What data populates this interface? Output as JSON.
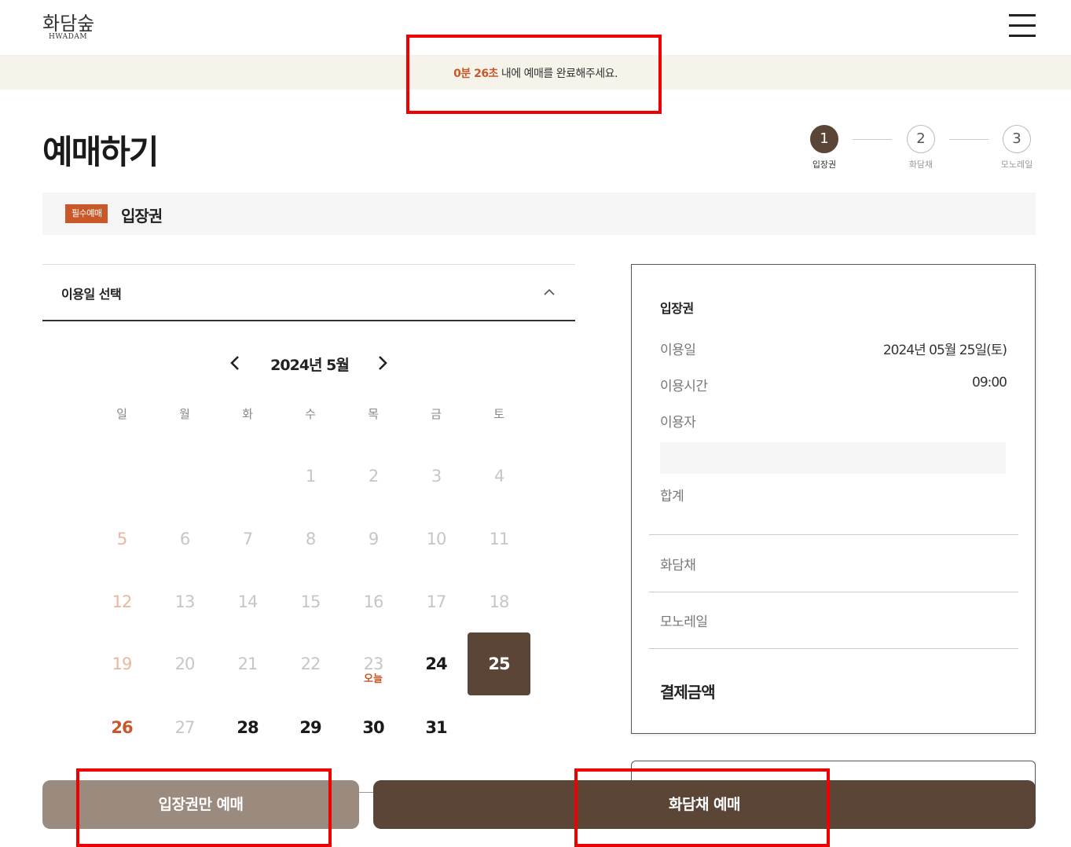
{
  "header": {
    "logo_ko": "화담숲",
    "logo_en": "HWADAM",
    "menu_icon": "hamburger-menu-icon"
  },
  "timer": {
    "count": "0분 26초",
    "message": " 내에 예매를 완료해주세요."
  },
  "page": {
    "title": "예매하기"
  },
  "stepper": {
    "steps": [
      {
        "number": "1",
        "label": "입장권",
        "active": true
      },
      {
        "number": "2",
        "label": "화담채",
        "active": false
      },
      {
        "number": "3",
        "label": "모노레일",
        "active": false
      }
    ]
  },
  "section": {
    "badge": "필수예매",
    "title": "입장권"
  },
  "date_picker": {
    "title": "이용일 선택",
    "month_label": "2024년 5월",
    "weekdays": [
      "일",
      "월",
      "화",
      "수",
      "목",
      "금",
      "토"
    ],
    "today_label": "오늘",
    "days": [
      "1",
      "2",
      "3",
      "4",
      "5",
      "6",
      "7",
      "8",
      "9",
      "10",
      "11",
      "12",
      "13",
      "14",
      "15",
      "16",
      "17",
      "18",
      "19",
      "20",
      "21",
      "22",
      "23",
      "24",
      "25",
      "26",
      "27",
      "28",
      "29",
      "30",
      "31"
    ]
  },
  "summary": {
    "title": "입장권",
    "rows": [
      {
        "label": "이용일",
        "value": "2024년 05월 25일(토)"
      },
      {
        "label": "이용시간",
        "value": "09:00"
      },
      {
        "label": "이용자",
        "value": ""
      },
      {
        "label": "합계",
        "value": ""
      }
    ],
    "restaurant_label": "화담채",
    "monorail_label": "모노레일",
    "total_label": "결제금액"
  },
  "buttons": {
    "ticket_only": "입장권만 예매",
    "restaurant": "화담채 예매"
  },
  "colors": {
    "accent": "#c8582a",
    "brown": "#5a4537",
    "light_brown": "#9b8a7e",
    "timer_bg": "#f6f3ea",
    "highlight_red": "#ee0000"
  }
}
